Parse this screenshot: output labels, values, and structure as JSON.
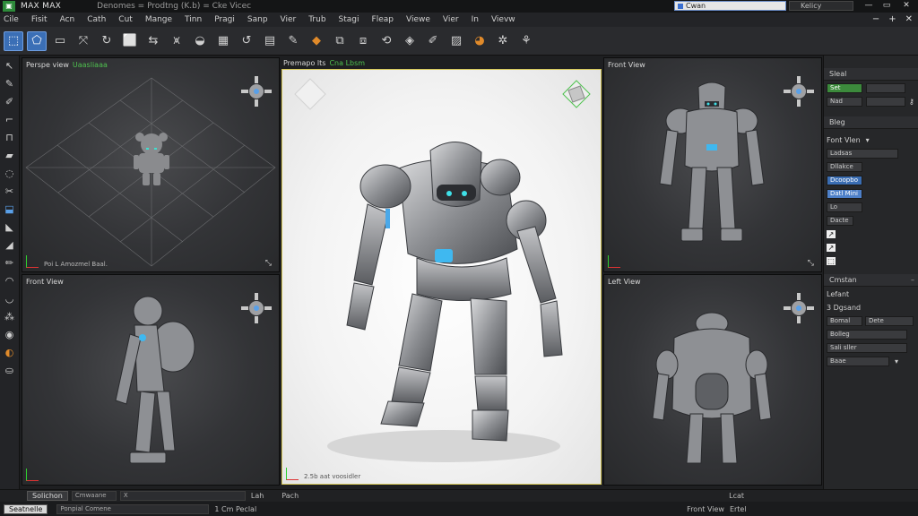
{
  "titlebar": {
    "app_title": "MAX MAX",
    "doc_title": "Denomes  =  Prodtng (K.b)  =  Cke Vicec",
    "search_value": "Cwan",
    "search2_value": "Kelicy"
  },
  "menu": [
    "Cile",
    "Fisit",
    "Acn",
    "Cath",
    "Cut",
    "Mange",
    "Tinn",
    "Pragi",
    "Sanp",
    "Vier",
    "Trub",
    "Stagi",
    "Fleap",
    "Viewe",
    "Vier",
    "In",
    "Vievw"
  ],
  "toolbar": {
    "tools": [
      {
        "icon": "select-arrow-icon",
        "glyph": "⬚",
        "active": true
      },
      {
        "icon": "select-region-icon",
        "glyph": "⬠",
        "active": true
      },
      {
        "icon": "folder-icon",
        "glyph": "▭",
        "active": false
      },
      {
        "icon": "move-icon",
        "glyph": "⤧",
        "active": false
      },
      {
        "icon": "rotate-icon",
        "glyph": "↻",
        "active": false
      },
      {
        "icon": "scale-icon",
        "glyph": "⬜",
        "active": false
      },
      {
        "icon": "snap-icon",
        "glyph": "⇆",
        "active": false
      },
      {
        "icon": "align-icon",
        "glyph": "⩙",
        "active": false
      },
      {
        "icon": "mirror-icon",
        "glyph": "◒",
        "active": false
      },
      {
        "icon": "array-icon",
        "glyph": "▦",
        "active": false
      },
      {
        "icon": "link-icon",
        "glyph": "↺",
        "active": false
      },
      {
        "icon": "layer-icon",
        "glyph": "▤",
        "active": false
      },
      {
        "icon": "pen-icon",
        "glyph": "✎",
        "active": false
      },
      {
        "icon": "material-icon",
        "glyph": "◆",
        "active": false,
        "style": "orange"
      },
      {
        "icon": "curve-icon",
        "glyph": "⧉",
        "active": false
      },
      {
        "icon": "group-icon",
        "glyph": "⧈",
        "active": false
      },
      {
        "icon": "render-setup-icon",
        "glyph": "⟲",
        "active": false
      },
      {
        "icon": "render-frame-icon",
        "glyph": "◈",
        "active": false
      },
      {
        "icon": "brush-icon",
        "glyph": "✐",
        "active": false
      },
      {
        "icon": "render-icon",
        "glyph": "▨",
        "active": false
      },
      {
        "icon": "teapot-icon",
        "glyph": "◕",
        "active": false,
        "style": "orange"
      },
      {
        "icon": "settings-icon",
        "glyph": "✲",
        "active": false
      },
      {
        "icon": "hierarchy-icon",
        "glyph": "⚘",
        "active": false
      }
    ]
  },
  "lefttools": [
    {
      "icon": "select-icon",
      "glyph": "↖"
    },
    {
      "icon": "paint-icon",
      "glyph": "✎"
    },
    {
      "icon": "knife-icon",
      "glyph": "✐"
    },
    {
      "icon": "bend-icon",
      "glyph": "⌐"
    },
    {
      "icon": "bridge-icon",
      "glyph": "⊓"
    },
    {
      "icon": "plane-icon",
      "glyph": "▰"
    },
    {
      "icon": "loop-icon",
      "glyph": "◌"
    },
    {
      "icon": "cut-icon",
      "glyph": "✂"
    },
    {
      "icon": "extrude-icon",
      "glyph": "⬓",
      "style": "hi"
    },
    {
      "icon": "chamfer-icon",
      "glyph": "◣"
    },
    {
      "icon": "weld-icon",
      "glyph": "◢"
    },
    {
      "icon": "pencil-icon",
      "glyph": "✏"
    },
    {
      "icon": "relax-icon",
      "glyph": "◠"
    },
    {
      "icon": "smooth-icon",
      "glyph": "◡"
    },
    {
      "icon": "spray-icon",
      "glyph": "⁂"
    },
    {
      "icon": "eye-icon",
      "glyph": "◉"
    },
    {
      "icon": "material-ball-icon",
      "glyph": "◐",
      "style": "or"
    },
    {
      "icon": "scene-icon",
      "glyph": "⛀"
    }
  ],
  "viewports": {
    "top_left": {
      "label": "Perspe view",
      "label_green": "Uaasliaaa",
      "footer": "Poi  L  Amozmel Baal."
    },
    "center": {
      "label": "Premapo lts",
      "label_green": "Cna Lbsm",
      "footer": "2.5b  aat  voosidler"
    },
    "top_right": {
      "label": "Front View"
    },
    "bottom_left": {
      "label": "Front View"
    },
    "bottom_right": {
      "label": "Left View"
    }
  },
  "rpanel": {
    "section1": "Sleal",
    "s1_row1": "Set",
    "s1_row2": "Nad",
    "section2": "Bleg",
    "front_view": "Font Vlen",
    "s2_field1": "Ladsas",
    "list_items": [
      "Dllakce",
      "Dcoopbo",
      "Datl Mini",
      "Lo"
    ],
    "list_sub": "Dacte",
    "section3": "Cmstan",
    "r3_1": "Lefant",
    "r3_2": "3 Dgsand",
    "r3_3a": "Bomal",
    "r3_3b": "Dete",
    "r3_4": "Bolleg",
    "r3_5": "Sali sller",
    "r3_6": "Baae"
  },
  "status": {
    "btn1": "Solichon",
    "field1": "Cmwaane",
    "field1_val": "X",
    "text1": "Lah",
    "text2": "Pach",
    "right_text": "Lcat",
    "btn2": "Seatnelle",
    "field2": "Ponpial Comene",
    "text3": "1 Cm  Peclal",
    "right_view": "Front View",
    "right_cnt": "Ertel"
  },
  "colors": {
    "accent": "#3b6fb6",
    "green": "#4fc24f",
    "viewport_highlight": "#d6c85a"
  }
}
